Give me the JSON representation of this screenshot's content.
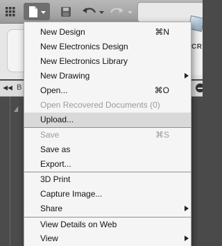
{
  "menu": {
    "items": [
      {
        "label": "New Design",
        "shortcut": "⌘N"
      },
      {
        "label": "New Electronics Design",
        "shortcut": ""
      },
      {
        "label": "New Electronics Library",
        "shortcut": ""
      },
      {
        "label": "New Drawing",
        "shortcut": ""
      },
      {
        "label": "Open...",
        "shortcut": "⌘O"
      },
      {
        "label": "Open Recovered Documents (0)",
        "shortcut": ""
      },
      {
        "label": "Upload...",
        "shortcut": ""
      },
      {
        "label": "Save",
        "shortcut": "⌘S"
      },
      {
        "label": "Save as",
        "shortcut": ""
      },
      {
        "label": "Export...",
        "shortcut": ""
      },
      {
        "label": "3D Print",
        "shortcut": ""
      },
      {
        "label": "Capture Image...",
        "shortcut": ""
      },
      {
        "label": "Share",
        "shortcut": ""
      },
      {
        "label": "View Details on Web",
        "shortcut": ""
      },
      {
        "label": "View",
        "shortcut": ""
      }
    ]
  },
  "ribbon": {
    "partial_label": "CRE"
  },
  "panel": {
    "partial_letter": "B"
  },
  "icons": {
    "grid": "app-grid-icon",
    "file": "file-icon",
    "save": "save-icon",
    "undo": "undo-icon",
    "redo": "redo-icon",
    "submenu": "chevron-right-icon"
  },
  "colors": {
    "menu_bg": "#f5f5f5",
    "highlight": "#d9d9d9",
    "disabled_text": "#9a9a9a",
    "toolbar": "#a8a8a8",
    "workspace": "#4b4b4b"
  }
}
